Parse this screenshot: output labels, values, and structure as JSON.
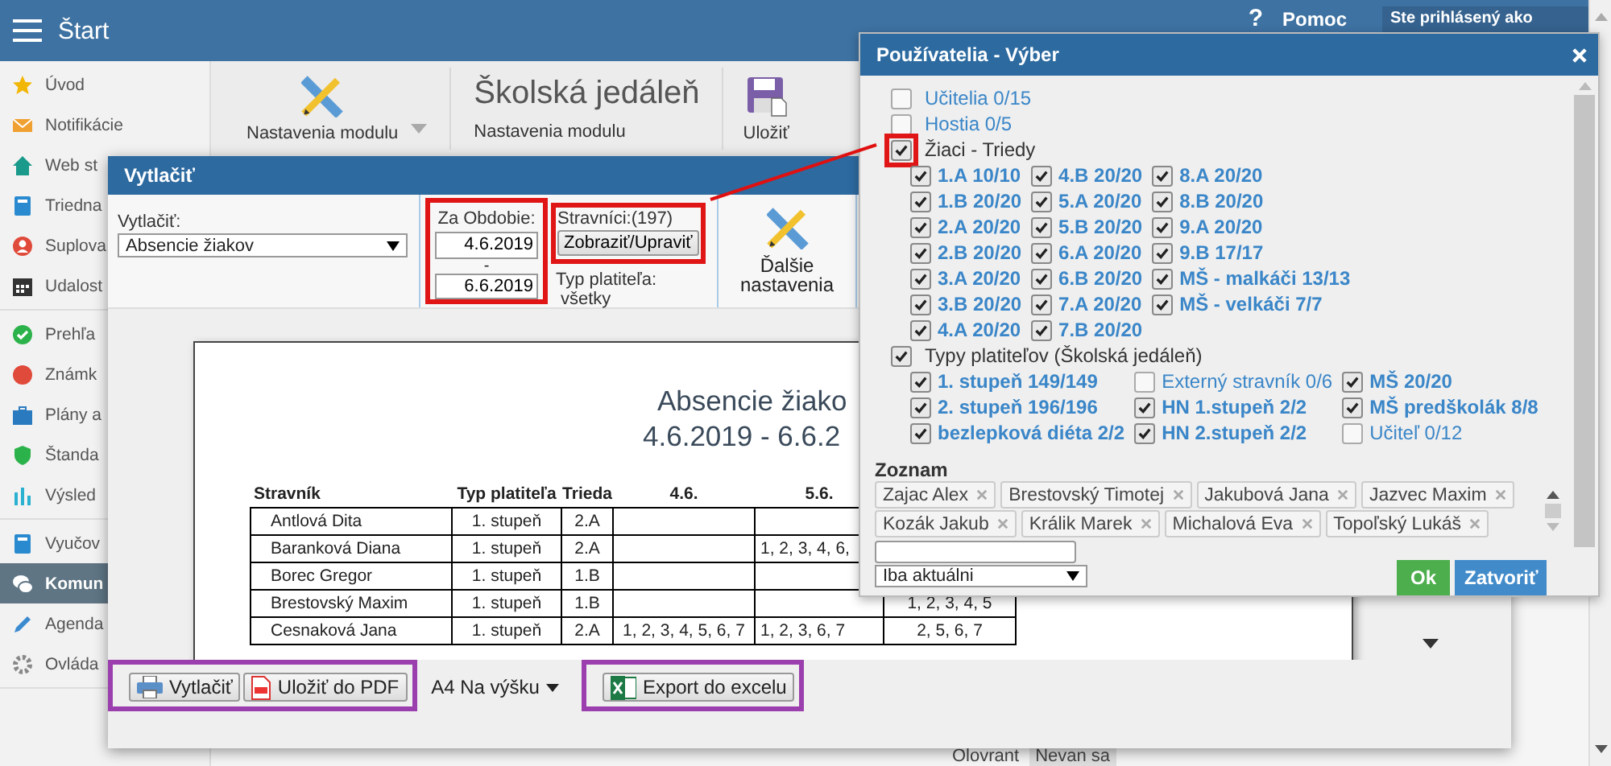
{
  "topbar": {
    "title": "Štart",
    "help_symbol": "?",
    "help": "Pomoc",
    "user_label": "Ste prihlásený ako"
  },
  "sidebar": {
    "groups": [
      {
        "items": [
          {
            "label": "Úvod",
            "selected": false
          },
          {
            "label": "Notifikácie",
            "selected": false
          },
          {
            "label": "Web st",
            "selected": false
          },
          {
            "label": "Triedna",
            "selected": false
          },
          {
            "label": "Suplova",
            "selected": false
          },
          {
            "label": "Udalost",
            "selected": false
          }
        ]
      },
      {
        "items": [
          {
            "label": "Prehľa",
            "selected": false
          },
          {
            "label": "Známk",
            "selected": false
          },
          {
            "label": "Plány a",
            "selected": false
          },
          {
            "label": "Štanda",
            "selected": false
          },
          {
            "label": "Výsled",
            "selected": false
          }
        ]
      },
      {
        "items": [
          {
            "label": "Vyučov",
            "selected": false
          },
          {
            "label": "Komun",
            "selected": true
          },
          {
            "label": "Agenda",
            "selected": false
          },
          {
            "label": "Ovláda",
            "selected": false
          }
        ]
      }
    ]
  },
  "ribbon": {
    "module_button": "Nastavenia modulu",
    "module_title": "Školská jedáleň",
    "module_subtitle": "Nastavenia modulu",
    "save_button": "Uložiť"
  },
  "background_footer": {
    "label": "Olovrant",
    "select": "Nevan sa"
  },
  "print_dialog": {
    "title": "Vytlačiť",
    "report_label": "Vytlačiť:",
    "report_value": "Absencie žiakov",
    "period": {
      "label": "Za Obdobie:",
      "from": "4.6.2019",
      "separator": "-",
      "to": "6.6.2019",
      "highlighted": true
    },
    "diners": {
      "label": "Stravníci:(197)",
      "button": "Zobraziť/Upraviť",
      "payer_label": "Typ platiteľa:",
      "payer_value": "všetky",
      "highlighted": true
    },
    "more_button": "Ďalšie nastavenia",
    "preview": {
      "title": "Absencie žiako",
      "subtitle": "4.6.2019 - 6.6.2",
      "columns": [
        "Stravník",
        "Typ platiteľa",
        "Trieda",
        "4.6.",
        "5.6."
      ],
      "rows": [
        {
          "cells": [
            "Antlová Dita",
            "1. stupeň",
            "2.A",
            null,
            null,
            null
          ]
        },
        {
          "cells": [
            "Baranková Diana",
            "1. stupeň",
            "2.A",
            null,
            "1, 2, 3, 4, 6,",
            null
          ]
        },
        {
          "cells": [
            "Borec Gregor",
            "1. stupeň",
            "1.B",
            null,
            null,
            null
          ]
        },
        {
          "cells": [
            "Brestovský Maxim",
            "1. stupeň",
            "1.B",
            null,
            null,
            "1, 2, 3, 4, 5"
          ]
        },
        {
          "cells": [
            "Cesnaková Jana",
            "1. stupeň",
            "2.A",
            "1, 2, 3, 4, 5, 6, 7",
            "1, 2, 3, 6, 7",
            "2, 5, 6, 7"
          ]
        }
      ]
    },
    "bottom_groups": [
      {
        "highlighted": true,
        "items": [
          {
            "kind": "print",
            "label": "Vytlačiť"
          },
          {
            "kind": "pdf",
            "label": "Uložiť do PDF"
          }
        ]
      },
      {
        "highlighted": false,
        "items": [
          {
            "kind": "dropdown",
            "label": "A4 Na výšku"
          }
        ]
      },
      {
        "highlighted": true,
        "items": [
          {
            "kind": "excel",
            "label": "Export do excelu"
          }
        ]
      }
    ]
  },
  "users_popup": {
    "title": "Používatelia - Výber",
    "groups": [
      {
        "label": "Učitelia 0/15",
        "checked": false,
        "highlighted": false
      },
      {
        "label": "Hostia 0/5",
        "checked": false,
        "highlighted": false
      },
      {
        "label": "Žiaci - Triedy",
        "checked": true,
        "highlighted": true,
        "children": [
          {
            "label": "1.A 10/10",
            "checked": true
          },
          {
            "label": "1.B 20/20",
            "checked": true
          },
          {
            "label": "2.A 20/20",
            "checked": true
          },
          {
            "label": "2.B 20/20",
            "checked": true
          },
          {
            "label": "3.A 20/20",
            "checked": true
          },
          {
            "label": "3.B 20/20",
            "checked": true
          },
          {
            "label": "4.A 20/20",
            "checked": true
          },
          {
            "label": "4.B 20/20",
            "checked": true
          },
          {
            "label": "5.A 20/20",
            "checked": true
          },
          {
            "label": "5.B 20/20",
            "checked": true
          },
          {
            "label": "6.A 20/20",
            "checked": true
          },
          {
            "label": "6.B 20/20",
            "checked": true
          },
          {
            "label": "7.A 20/20",
            "checked": true
          },
          {
            "label": "7.B 20/20",
            "checked": true
          },
          {
            "label": "8.A 20/20",
            "checked": true
          },
          {
            "label": "8.B 20/20",
            "checked": true
          },
          {
            "label": "9.A 20/20",
            "checked": true
          },
          {
            "label": "9.B 17/17",
            "checked": true
          },
          {
            "label": "MŠ - malkáči 13/13",
            "checked": true
          },
          {
            "label": "MŠ - velkáči 7/7",
            "checked": true
          }
        ]
      },
      {
        "label": "Typy platiteľov (Školská jedáleň)",
        "checked": true,
        "highlighted": false,
        "children": [
          {
            "label": "1. stupeň 149/149",
            "checked": true
          },
          {
            "label": "2. stupeň 196/196",
            "checked": true
          },
          {
            "label": "bezlepková diéta 2/2",
            "checked": true
          },
          {
            "label": "Externý stravník 0/6",
            "checked": false
          },
          {
            "label": "HN 1.stupeň 2/2",
            "checked": true
          },
          {
            "label": "HN 2.stupeň 2/2",
            "checked": true
          },
          {
            "label": "MŠ 20/20",
            "checked": true
          },
          {
            "label": "MŠ predškolák 8/8",
            "checked": true
          },
          {
            "label": "Učiteľ 0/12",
            "checked": false
          }
        ]
      }
    ],
    "list_label": "Zoznam",
    "tags": [
      "Zajac Alex",
      "Brestovský Timotej",
      "Jakubová Jana",
      "Jazvec Maxim",
      "Kozák Jakub",
      "Králik Marek",
      "Michalová Eva",
      "Topoľský Lukáš"
    ],
    "filter_select": "Iba aktuálni",
    "ok_button": "Ok",
    "close_button": "Zatvoriť"
  }
}
